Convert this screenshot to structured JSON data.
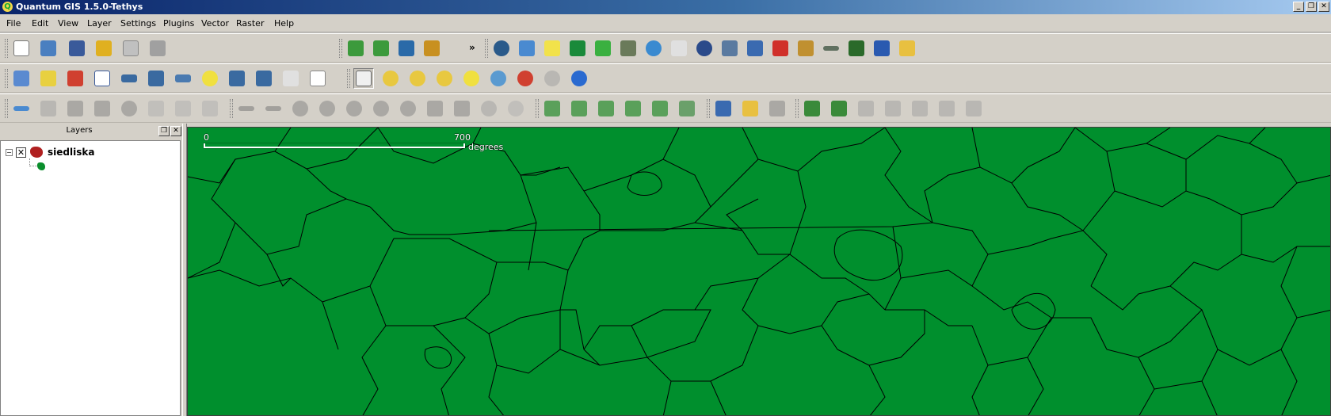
{
  "window": {
    "title": "Quantum GIS 1.5.0-Tethys"
  },
  "menu": [
    "File",
    "Edit",
    "View",
    "Layer",
    "Settings",
    "Plugins",
    "Vector",
    "Raster",
    "Help"
  ],
  "toolbar_overflow": "»",
  "layers_panel": {
    "title": "Layers",
    "layer": {
      "name": "siedliska",
      "visible_check": "✕",
      "expander": "−"
    }
  },
  "scalebar": {
    "zero": "0",
    "max": "700",
    "unit": "degrees"
  },
  "colors": {
    "map_fill": "#008f2d",
    "boundary": "#000000",
    "title_gradient_start": "#0a246a"
  }
}
